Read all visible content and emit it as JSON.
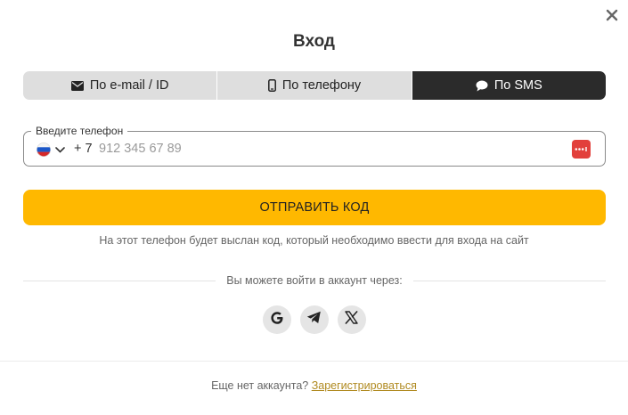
{
  "modal": {
    "title": "Вход",
    "close_icon": "close-icon"
  },
  "tabs": [
    {
      "label": "По e-mail / ID",
      "icon": "envelope-icon",
      "active": false
    },
    {
      "label": "По телефону",
      "icon": "smartphone-icon",
      "active": false
    },
    {
      "label": "По SMS",
      "icon": "chat-bubble-icon",
      "active": true
    }
  ],
  "phone_field": {
    "label": "Введите телефон",
    "country_flag": "russia-flag-icon",
    "prefix": "+ 7",
    "value": "",
    "placeholder": "912 345 67 89",
    "password_manager_icon": "password-manager-icon"
  },
  "send_button": {
    "label": "ОТПРАВИТЬ КОД"
  },
  "hint": "На этот телефон будет выслан код, который необходимо ввести для входа на сайт",
  "social": {
    "divider_text": "Вы можете войти в аккаунт через:",
    "providers": [
      {
        "icon": "google-icon"
      },
      {
        "icon": "telegram-icon"
      },
      {
        "icon": "x-icon"
      }
    ]
  },
  "footer": {
    "text": "Еще нет аккаунта?",
    "link": "Зарегистрироваться"
  },
  "colors": {
    "accent": "#ffb800",
    "tab_active": "#2b2b2b",
    "tab_inactive": "#dedede",
    "link": "#b08a20",
    "password_icon": "#e2403c"
  }
}
